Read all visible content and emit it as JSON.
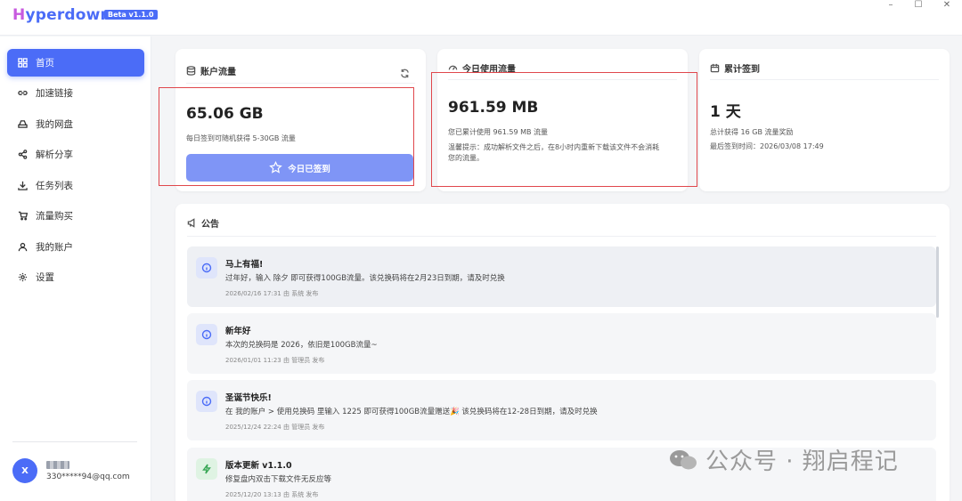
{
  "app": {
    "title_part1": "H",
    "title_part2": "yperdown",
    "version_badge": "Beta v1.1.0"
  },
  "window_controls": {
    "minimize": "–",
    "maximize": "☐",
    "close": "✕"
  },
  "sidebar": {
    "items": [
      {
        "label": "首页",
        "icon": "home-grid-icon",
        "active": true
      },
      {
        "label": "加速链接",
        "icon": "link-icon"
      },
      {
        "label": "我的网盘",
        "icon": "drive-icon"
      },
      {
        "label": "解析分享",
        "icon": "share-icon"
      },
      {
        "label": "任务列表",
        "icon": "download-icon"
      },
      {
        "label": "流量购买",
        "icon": "cart-icon"
      },
      {
        "label": "我的账户",
        "icon": "user-icon"
      },
      {
        "label": "设置",
        "icon": "gear-icon"
      }
    ],
    "user": {
      "avatar_letter": "X",
      "email": "330*****94@qq.com"
    }
  },
  "cards": {
    "traffic": {
      "title": "账户流量",
      "value": "65.06 GB",
      "desc": "每日签到可随机获得 5-30GB 流量",
      "button": "今日已签到"
    },
    "today": {
      "title": "今日使用流量",
      "value": "961.59 MB",
      "desc": "您已累计使用 961.59 MB 流量",
      "tip_line1": "温馨提示：成功解析文件之后，在8小时内重新下载该文件不会消耗",
      "tip_line2": "您的流量。"
    },
    "checkin": {
      "title": "累计签到",
      "value": "1 天",
      "total": "总计获得 16 GB 流量奖励",
      "last": "最后签到时间：2026/03/08 17:49"
    }
  },
  "announcements": {
    "title": "公告",
    "items": [
      {
        "title": "马上有福!",
        "body": "过年好，输入 除夕 即可获得100GB流量。该兑换码将在2月23日到期，请及时兑换",
        "meta": "2026/02/16 17:31    由 系统 发布"
      },
      {
        "title": "新年好",
        "body": "本次的兑换码是 2026，依旧是100GB流量~",
        "meta": "2026/01/01 11:23    由 管理员 发布"
      },
      {
        "title": "圣诞节快乐!",
        "body": "在 我的账户 > 使用兑换码 里输入 1225 即可获得100GB流量赠送🎉 该兑换码将在12-28日到期，请及时兑换",
        "meta": "2025/12/24 22:24    由 管理员 发布"
      },
      {
        "title": "版本更新 v1.1.0",
        "body": "修复盘内双击下载文件无反应等",
        "meta": "2025/12/20 13:13    由 系统 发布"
      }
    ]
  },
  "watermark": {
    "text": "公众号 · 翔启程记"
  },
  "colors": {
    "accent": "#4b6cf7",
    "highlight_box": "#e0474c"
  }
}
